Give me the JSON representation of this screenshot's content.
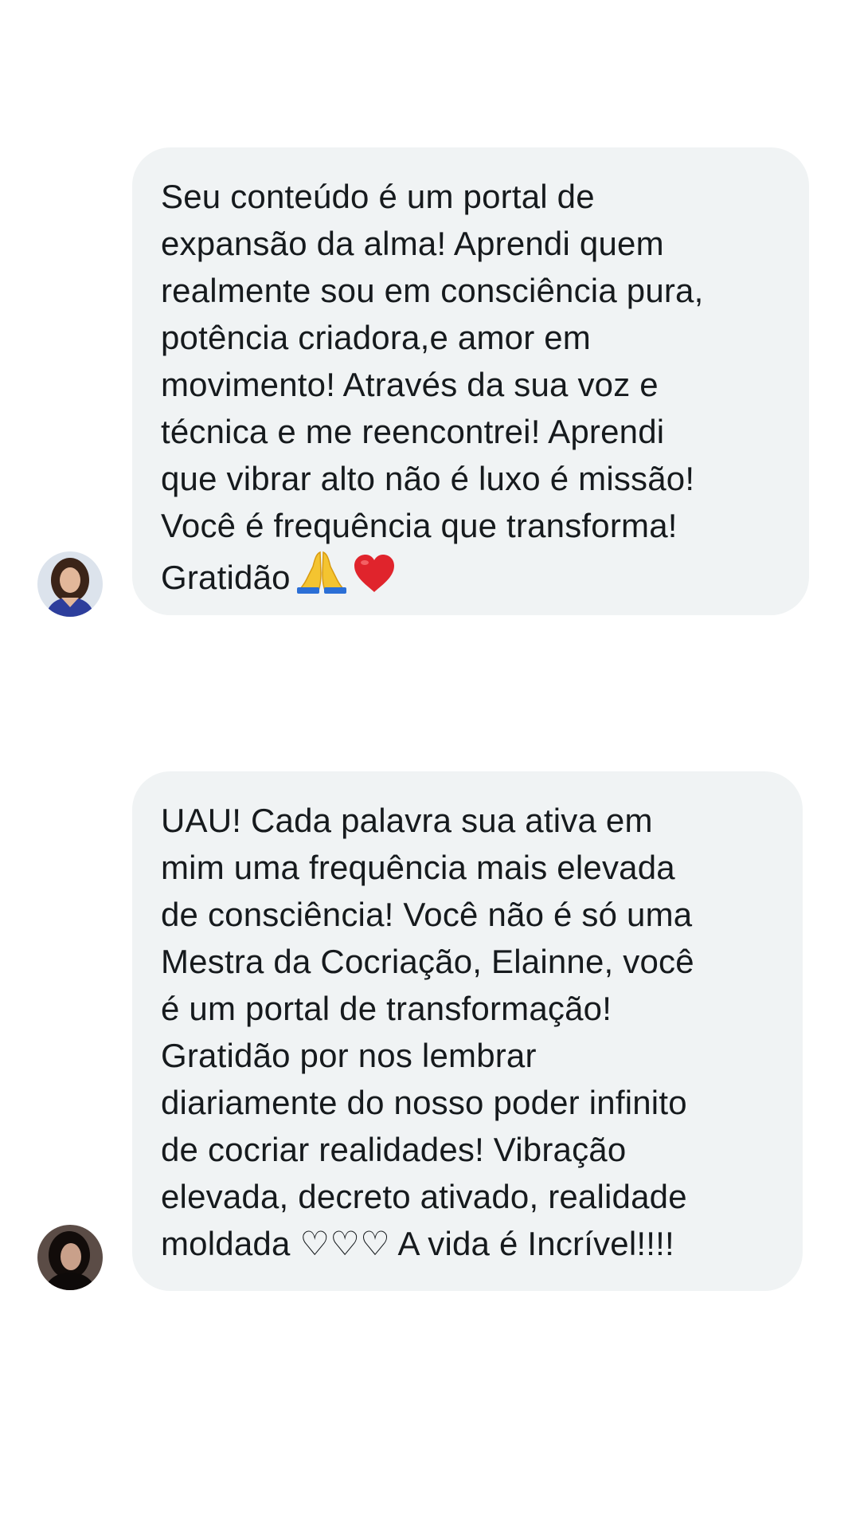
{
  "messages": [
    {
      "lines": [
        "Seu conteúdo é um portal de",
        "expansão da alma! Aprendi quem",
        "realmente sou em consciência pura,",
        "potência criadora,e amor em",
        "movimento! Através da sua voz e",
        "técnica e me reencontrei! Aprendi",
        "que vibrar alto não é luxo é missão!",
        "Você é frequência que transforma!",
        "Gratidão"
      ],
      "trailing_emojis": [
        "folded-hands-emoji",
        "red-heart-emoji"
      ]
    },
    {
      "lines": [
        "UAU! Cada palavra sua ativa em",
        "mim uma frequência mais elevada",
        "de consciência! Você não é só uma",
        "Mestra da Cocriação, Elainne, você",
        "é um portal de transformação!",
        "Gratidão por nos lembrar",
        "diariamente do nosso poder infinito",
        "de cocriar realidades! Vibração",
        "elevada, decreto ativado, realidade",
        "moldada ♡♡♡ A vida é Incrível!!!!"
      ]
    }
  ],
  "colors": {
    "bubble_background": "#f0f3f4",
    "text": "#161a1d",
    "page_background": "#ffffff",
    "heart": "#e0242c",
    "pray_hands": "#f4c430"
  }
}
